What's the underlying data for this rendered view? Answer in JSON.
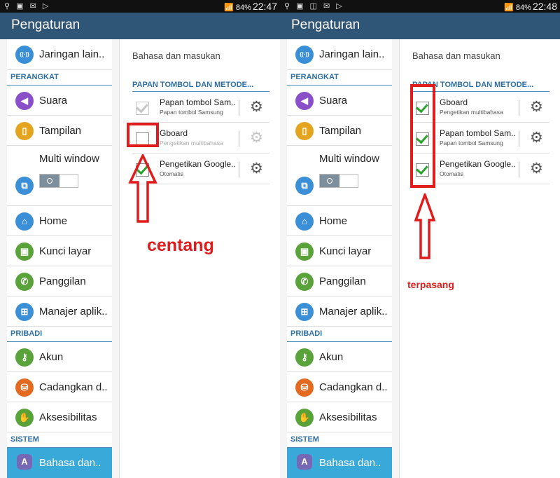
{
  "left_screen": {
    "status": {
      "icons": "⚲ ▣ ✉ ▷",
      "battery": "84%",
      "time": "22:47"
    },
    "app_title": "Pengaturan",
    "settings_menu": [
      {
        "type": "item",
        "label": "Jaringan lain..",
        "icon": "wifi-icon",
        "color": "#3a8fd6"
      },
      {
        "type": "section",
        "label": "PERANGKAT"
      },
      {
        "type": "item",
        "label": "Suara",
        "icon": "volume-icon",
        "color": "#8a4fc9"
      },
      {
        "type": "item",
        "label": "Tampilan",
        "icon": "display-icon",
        "color": "#e3a520"
      },
      {
        "type": "item",
        "label": "Multi window",
        "icon": "multi-window-icon",
        "color": "#3a8fd6"
      },
      {
        "type": "item",
        "label": "Home",
        "icon": "home-icon",
        "color": "#3a8fd6"
      },
      {
        "type": "item",
        "label": "Kunci layar",
        "icon": "lock-icon",
        "color": "#5aa33a"
      },
      {
        "type": "item",
        "label": "Panggilan",
        "icon": "phone-icon",
        "color": "#5aa33a"
      },
      {
        "type": "item",
        "label": "Manajer aplik..",
        "icon": "apps-icon",
        "color": "#3a8fd6"
      },
      {
        "type": "section",
        "label": "PRIBADI"
      },
      {
        "type": "item",
        "label": "Akun",
        "icon": "key-icon",
        "color": "#5aa33a"
      },
      {
        "type": "item",
        "label": "Cadangkan d..",
        "icon": "backup-icon",
        "color": "#e26a21"
      },
      {
        "type": "item",
        "label": "Aksesibilitas",
        "icon": "hand-icon",
        "color": "#5aa33a"
      },
      {
        "type": "section",
        "label": "SISTEM"
      },
      {
        "type": "item",
        "label": "Bahasa dan..",
        "icon": "language-icon",
        "color": "#7768b5",
        "selected": true
      }
    ],
    "detail_title": "Bahasa dan masukan",
    "detail_section": "PAPAN TOMBOL DAN METODE...",
    "keyboards": [
      {
        "name": "Papan tombol Sam..",
        "sub": "Papan tombol Samsung",
        "checked": true,
        "disabled": true
      },
      {
        "name": "Gboard",
        "sub": "Pengetikan multibahasa",
        "checked": false,
        "disabled": false,
        "gear_disabled": true
      },
      {
        "name": "Pengetikan Google..",
        "sub": "Otomatis",
        "checked": true,
        "disabled": false
      }
    ],
    "annotation": "centang"
  },
  "right_screen": {
    "status": {
      "icons": "⚲ ▣ ◫ ✉ ▷",
      "battery": "84%",
      "time": "22:48"
    },
    "app_title": "Pengaturan",
    "detail_title": "Bahasa dan masukan",
    "detail_section": "PAPAN TOMBOL DAN METODE...",
    "keyboards": [
      {
        "name": "Gboard",
        "sub": "Pengetikan multibahasa",
        "checked": true,
        "disabled": false
      },
      {
        "name": "Papan tombol Sam..",
        "sub": "Papan tombol Samsung",
        "checked": true,
        "disabled": false
      },
      {
        "name": "Pengetikan Google..",
        "sub": "Otomatis",
        "checked": true,
        "disabled": false
      }
    ],
    "annotation": "terpasang"
  },
  "icon_glyphs": {
    "wifi-icon": "((·))",
    "volume-icon": "◀",
    "display-icon": "▯",
    "multi-window-icon": "⧉",
    "home-icon": "⌂",
    "lock-icon": "▣",
    "phone-icon": "✆",
    "apps-icon": "⊞",
    "key-icon": "⚷",
    "backup-icon": "⛁",
    "hand-icon": "✋",
    "language-icon": "A",
    "gear-icon": "⚙"
  }
}
